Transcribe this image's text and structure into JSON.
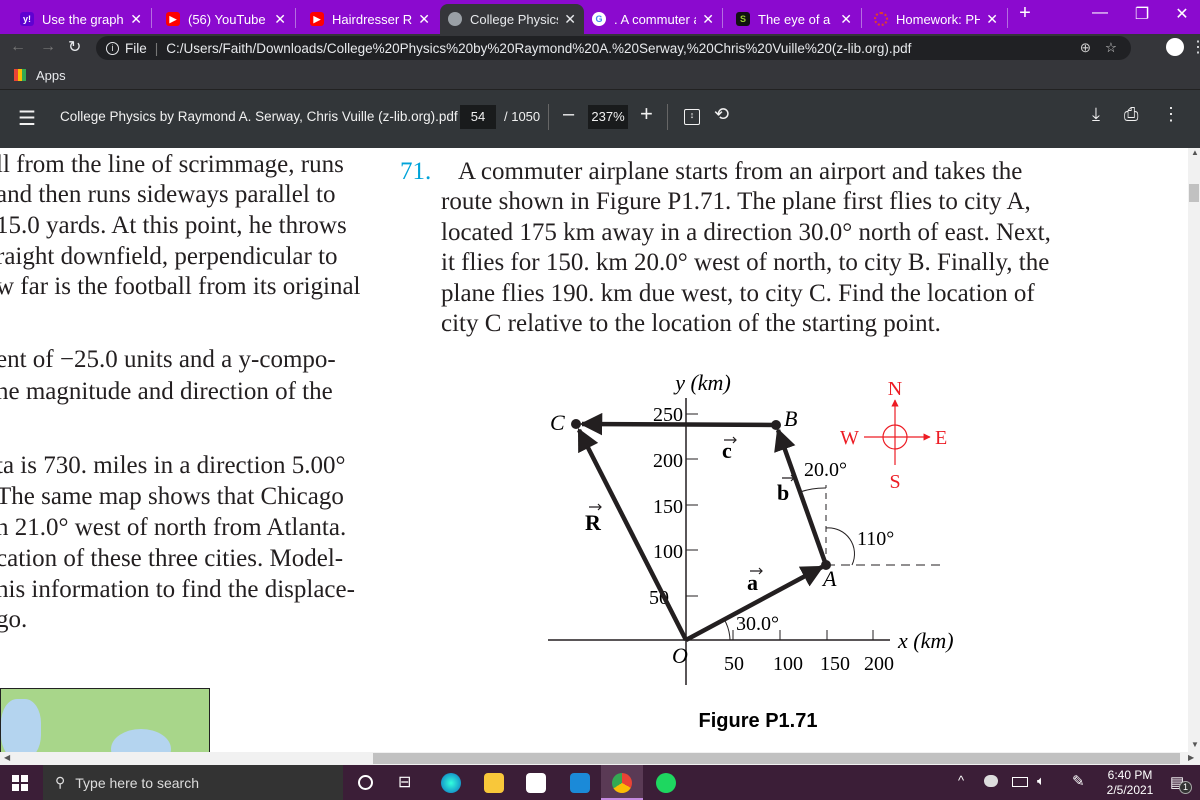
{
  "browser": {
    "tabs": [
      {
        "label": "Use the graph of th",
        "icon": "yahoo-icon",
        "color": "#5f01d1"
      },
      {
        "label": "(56) YouTube",
        "icon": "youtube-icon",
        "color": "#ff0000"
      },
      {
        "label": "Hairdresser Reacts",
        "icon": "youtube-icon",
        "color": "#ff0000"
      },
      {
        "label": "College Physics by",
        "icon": "globe-icon",
        "color": "#9aa0a6",
        "active": true
      },
      {
        "label": ". A commuter airpl",
        "icon": "google-icon",
        "color": "#4285f4"
      },
      {
        "label": "The eye of a hurric",
        "icon": "s-icon",
        "color": "#9acd32"
      },
      {
        "label": "Homework: PHYS-",
        "icon": "canvas-icon",
        "color": "#e13f2b"
      }
    ],
    "address_scheme": "File",
    "url": "C:/Users/Faith/Downloads/College%20Physics%20by%20Raymond%20A.%20Serway,%20Chris%20Vuille%20(z-lib.org).pdf",
    "bookmarks_apps": "Apps"
  },
  "pdf": {
    "title": "College Physics by Raymond A. Serway, Chris Vuille (z-lib.org).pdf",
    "page_current": "54",
    "page_total": "/ 1050",
    "zoom": "237%"
  },
  "left_column": [
    "ll from the line of scrimmage, runs",
    "and then runs sideways parallel to",
    "15.0 yards. At this point, he throws",
    "raight downfield, perpendicular to",
    "w far is the football from its original",
    "ent of −25.0 units and a y-compo-",
    "ne magnitude and direction of the",
    "ta is 730. miles in a direction 5.00°",
    "The same map shows that Chicago",
    "n 21.0° west of north from Atlanta.",
    "cation of these three cities. Model-",
    "his information to find the displace-",
    "go."
  ],
  "problem": {
    "number": "71.",
    "number_color": "#00a3d9",
    "lines": [
      "A commuter airplane starts from an airport and takes the",
      "route shown in Figure P1.71. The plane first flies to city A,",
      "located 175 km away in a direction 30.0° north of east. Next,",
      "it flies for 150. km 20.0° west of north, to city B. Finally, the",
      "plane flies 190. km due west, to city C. Find the location of",
      "city C relative to the location of the starting point."
    ]
  },
  "figure": {
    "caption": "Figure P1.71",
    "y_axis_label": "y (km)",
    "x_axis_label": "x (km)",
    "origin_label": "O",
    "x_ticks": [
      "50",
      "100",
      "150",
      "200"
    ],
    "y_ticks": [
      "50",
      "100",
      "150",
      "200",
      "250"
    ],
    "points": {
      "A": "A",
      "B": "B",
      "C": "C"
    },
    "vectors": {
      "a": "a",
      "b": "b",
      "c": "c",
      "R": "R"
    },
    "angles": [
      "30.0°",
      "20.0°",
      "110°"
    ],
    "compass": {
      "N": "N",
      "S": "S",
      "E": "E",
      "W": "W",
      "color": "#ed1c24"
    }
  },
  "taskbar": {
    "search_placeholder": "Type here to search",
    "time": "6:40 PM",
    "date": "2/5/2021",
    "notifications": "1"
  }
}
